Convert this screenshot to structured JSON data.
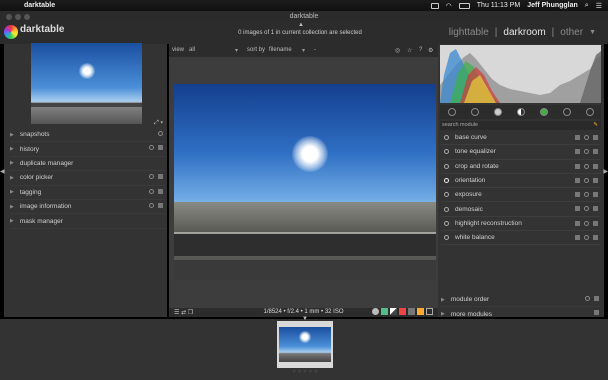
{
  "menubar": {
    "app": "darktable",
    "clock": "Thu 11:13 PM",
    "user": "Jeff Phungglan"
  },
  "window": {
    "title": "darktable"
  },
  "header": {
    "logo_text": "darktable",
    "status": "0 images of 1 in current collection are selected",
    "views": [
      "lighttable",
      "darkroom",
      "other"
    ],
    "active_view": "darkroom",
    "separator": "|"
  },
  "topbar": {
    "view_label": "view",
    "view_value": "all",
    "sort_label": "sort by",
    "sort_value": "filename",
    "sort_order": "-"
  },
  "left_modules": [
    {
      "label": "snapshots"
    },
    {
      "label": "history"
    },
    {
      "label": "duplicate manager"
    },
    {
      "label": "color picker"
    },
    {
      "label": "tagging"
    },
    {
      "label": "image information"
    },
    {
      "label": "mask manager"
    }
  ],
  "right_search": {
    "placeholder": "search module"
  },
  "right_modules": [
    {
      "label": "base curve"
    },
    {
      "label": "tone equalizer"
    },
    {
      "label": "crop and rotate"
    },
    {
      "label": "orientation"
    },
    {
      "label": "exposure"
    },
    {
      "label": "demosaic"
    },
    {
      "label": "highlight reconstruction"
    },
    {
      "label": "white balance"
    }
  ],
  "bottom_modules": [
    {
      "label": "module order"
    },
    {
      "label": "more modules"
    }
  ],
  "image_info": "1/8524 • f/2.4 • 1 mm • 32 ISO",
  "filmstrip": {
    "rating": "★★★★★"
  },
  "colors": {
    "accent": "#e6e6e6",
    "panel": "#333333",
    "center": "#3d3d3d"
  }
}
